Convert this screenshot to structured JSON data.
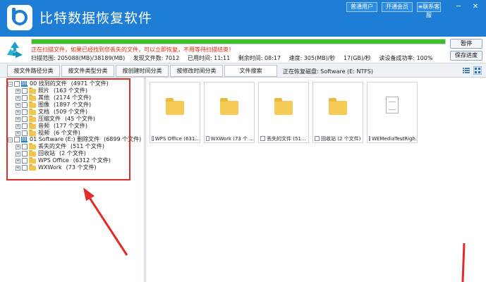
{
  "app": {
    "title": "比特数据恢复软件",
    "buttons": [
      "普通用户",
      "开通会员",
      "联系客服"
    ],
    "window_controls": [
      "─",
      "✕"
    ]
  },
  "scan": {
    "progress_percent": 100,
    "status_message": "正在扫描文件，如果已经找到您丢失的文件，可以立即恢复，不用等待扫描结束！",
    "stats": [
      "扫描范围: 205088(MB)/38189(MB)",
      "发现文件数: 7012",
      "已用时间: 11:11",
      "剩余时间: 08:17",
      "速度: 305(MB)/秒",
      "17(GB)/秒",
      "读设备成功率: 100%"
    ],
    "pause_label": "暂停",
    "save_progress_label": "保存进度"
  },
  "tabs": [
    "按文件路径分类",
    "按文件类型分类",
    "按创建时间分类",
    "按修改时间分类",
    "文件搜索"
  ],
  "current_disk": "正在恢复磁盘: Software (E: NTFS)",
  "tree": {
    "found": {
      "label": "00 找到的文件",
      "count": "(4971 个文件)",
      "children": [
        {
          "label": "照片",
          "count": "(163 个文件)"
        },
        {
          "label": "其他",
          "count": "(2174 个文件)"
        },
        {
          "label": "图像",
          "count": "(1897 个文件)"
        },
        {
          "label": "文档",
          "count": "(509 个文件)"
        },
        {
          "label": "压缩文件",
          "count": "(45 个文件)"
        },
        {
          "label": "音频",
          "count": "(177 个文件)"
        },
        {
          "label": "视频",
          "count": "(6 个文件)"
        }
      ]
    },
    "deleted": {
      "label": "01 Software (E:) 删除文件",
      "count": "(6899 个文件)",
      "children": [
        {
          "label": "丢失的文件",
          "count": "(511 个文件)"
        },
        {
          "label": "回收站",
          "count": "(2 个文件)"
        },
        {
          "label": "WPS Office",
          "count": "(6312 个文件)"
        },
        {
          "label": "WXWork",
          "count": "(73 个文件)"
        }
      ]
    }
  },
  "files": [
    {
      "name": "WPS Office (631...",
      "icon": "folder-icon"
    },
    {
      "name": "WXWork (73 个 ...",
      "icon": "folder-icon"
    },
    {
      "name": "丢失的文件 (51...",
      "icon": "folder-icon"
    },
    {
      "name": "回收站 (2 个文件)",
      "icon": "folder-icon"
    },
    {
      "name": "WEMediaTestRigh...",
      "icon": "document-icon"
    }
  ],
  "colors": {
    "title_bar": "#1e7ed6",
    "progress": "#3fbf2a",
    "status_text": "#e4260e",
    "annotation": "#e52a2a"
  }
}
